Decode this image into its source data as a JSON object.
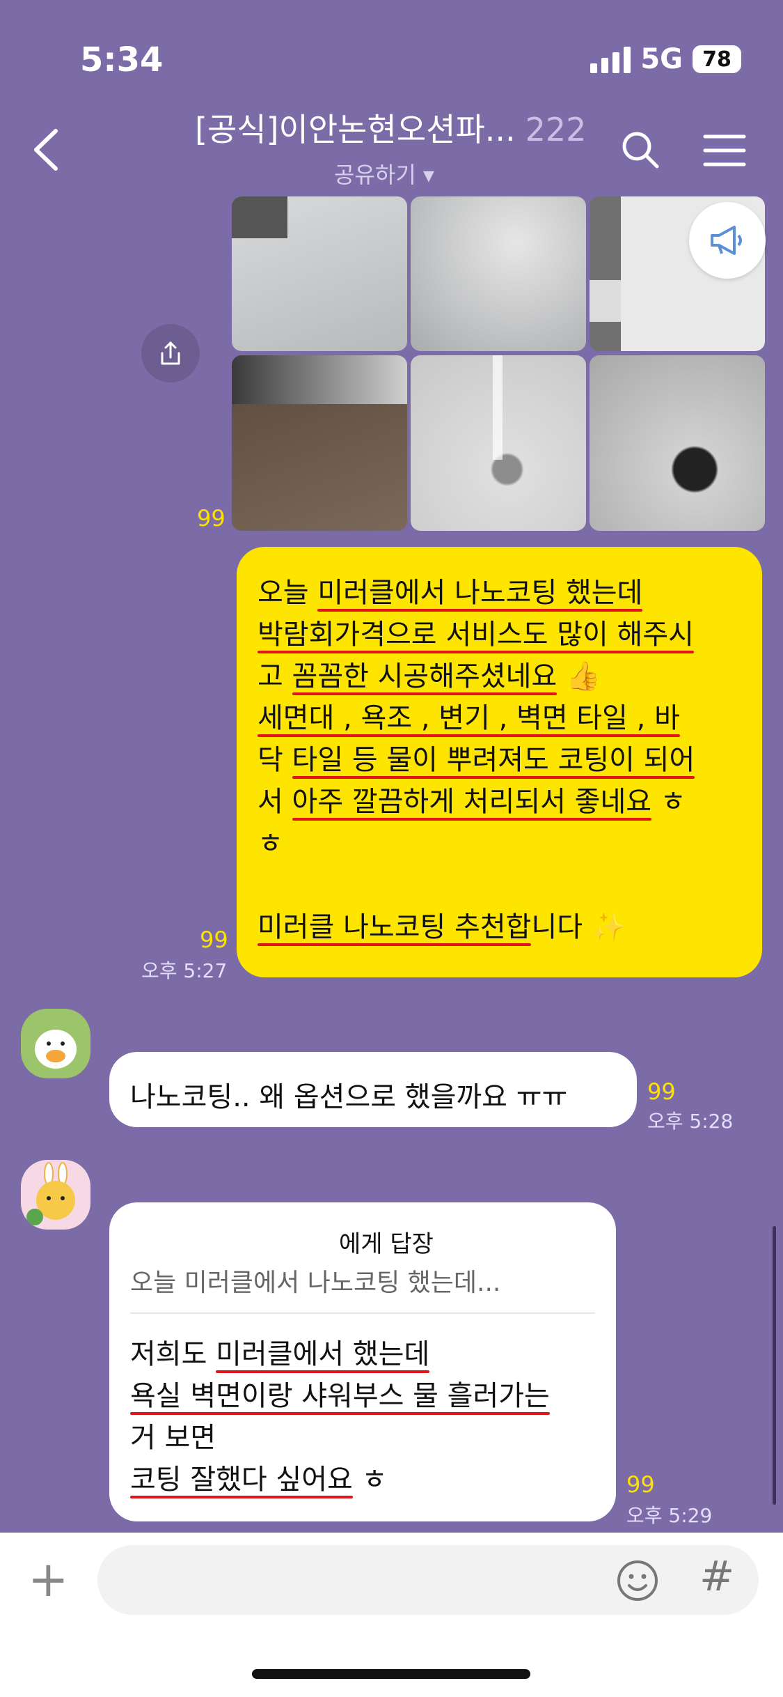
{
  "status": {
    "time": "5:34",
    "network": "5G",
    "battery": "78"
  },
  "header": {
    "title": "[공식]이안논현오션파...",
    "member_count": "222",
    "subtitle": "공유하기 ▾"
  },
  "photo_block": {
    "unread": "99"
  },
  "my_message": {
    "lines": [
      "오늘 미러클에서 나노코팅 했는데",
      "박람회가격으로 서비스도 많이 해주시",
      "고 꼼꼼한 시공해주셨네요 👍",
      "세면대 , 욕조 , 변기 , 벽면 타일 , 바",
      "닥 타일 등 물이 뿌려져도 코팅이 되어",
      "서 아주 깔끔하게 처리되서 좋네요 ㅎ",
      "ㅎ",
      "",
      "미러클 나노코팅 추천합니다 ✨"
    ],
    "unread": "99",
    "time": "오후 5:27"
  },
  "message_2": {
    "text": "나노코팅.. 왜 옵션으로 했을까요 ㅠㅠ",
    "unread": "99",
    "time": "오후 5:28"
  },
  "message_3": {
    "reply_header": "에게 답장",
    "reply_preview": "오늘 미러클에서 나노코팅 했는데...",
    "lines": [
      "저희도 미러클에서 했는데",
      "욕실 벽면이랑 샤워부스 물 흘러가는",
      "거 보면",
      "코팅 잘했다 싶어요 ㅎ"
    ],
    "unread": "99",
    "time": "오후 5:29"
  },
  "input": {
    "plus": "+",
    "hash": "#"
  }
}
